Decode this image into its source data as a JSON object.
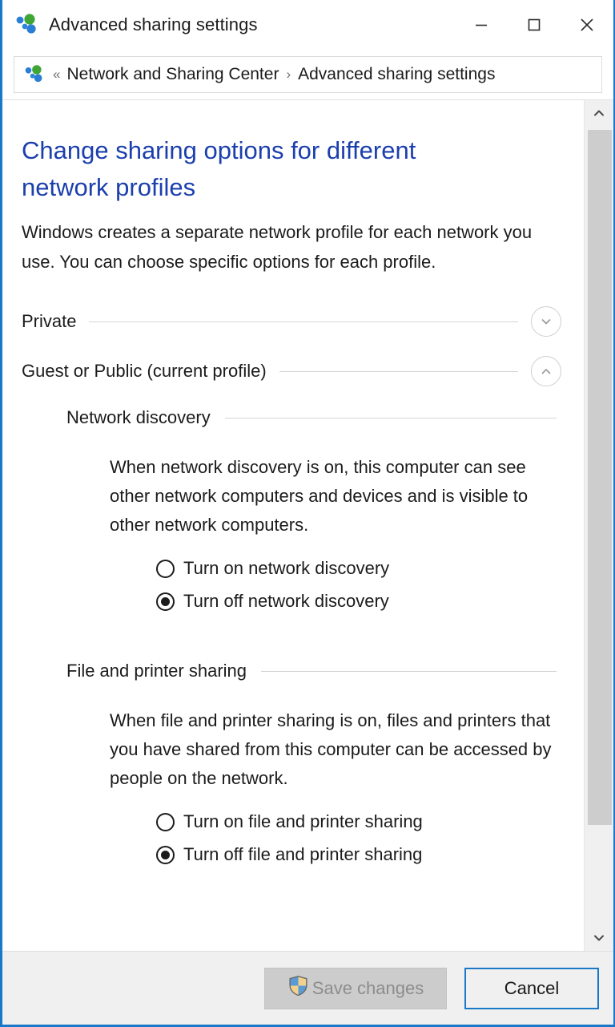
{
  "window": {
    "title": "Advanced sharing settings",
    "icon": "network-sharing-icon",
    "controls": {
      "minimize": "minimize-icon",
      "maximize": "maximize-icon",
      "close": "close-icon"
    }
  },
  "addressbar": {
    "icon": "network-sharing-icon",
    "back_chevrons": "«",
    "separator": "›",
    "crumbs": [
      {
        "label": "Network and Sharing Center"
      },
      {
        "label": "Advanced sharing settings"
      }
    ]
  },
  "main": {
    "heading": "Change sharing options for different network profiles",
    "intro": "Windows creates a separate network profile for each network you use. You can choose specific options for each profile.",
    "profiles": [
      {
        "label": "Private",
        "expanded": false,
        "chevron": "chevron-down-icon"
      },
      {
        "label": "Guest or Public (current profile)",
        "expanded": true,
        "chevron": "chevron-up-icon"
      }
    ],
    "sections": [
      {
        "label": "Network discovery",
        "description": "When network discovery is on, this computer can see other network computers and devices and is visible to other network computers.",
        "options": [
          {
            "label": "Turn on network discovery",
            "selected": false
          },
          {
            "label": "Turn off network discovery",
            "selected": true
          }
        ]
      },
      {
        "label": "File and printer sharing",
        "description": "When file and printer sharing is on, files and printers that you have shared from this computer can be accessed by people on the network.",
        "options": [
          {
            "label": "Turn on file and printer sharing",
            "selected": false
          },
          {
            "label": "Turn off file and printer sharing",
            "selected": true
          }
        ]
      }
    ]
  },
  "scrollbar": {
    "up_arrow": "scroll-up-icon",
    "down_arrow": "scroll-down-icon"
  },
  "footer": {
    "save_label": "Save changes",
    "save_icon": "uac-shield-icon",
    "save_disabled": true,
    "cancel_label": "Cancel"
  },
  "colors": {
    "accent": "#1a78c8",
    "heading": "#1c3fae",
    "text": "#1b1b1b",
    "rule": "#d4d4d4",
    "footer_bg": "#f0f0f0",
    "disabled_text": "#8d8d8d",
    "shield_blue": "#5b9bd5",
    "shield_gold": "#f2d18c"
  }
}
